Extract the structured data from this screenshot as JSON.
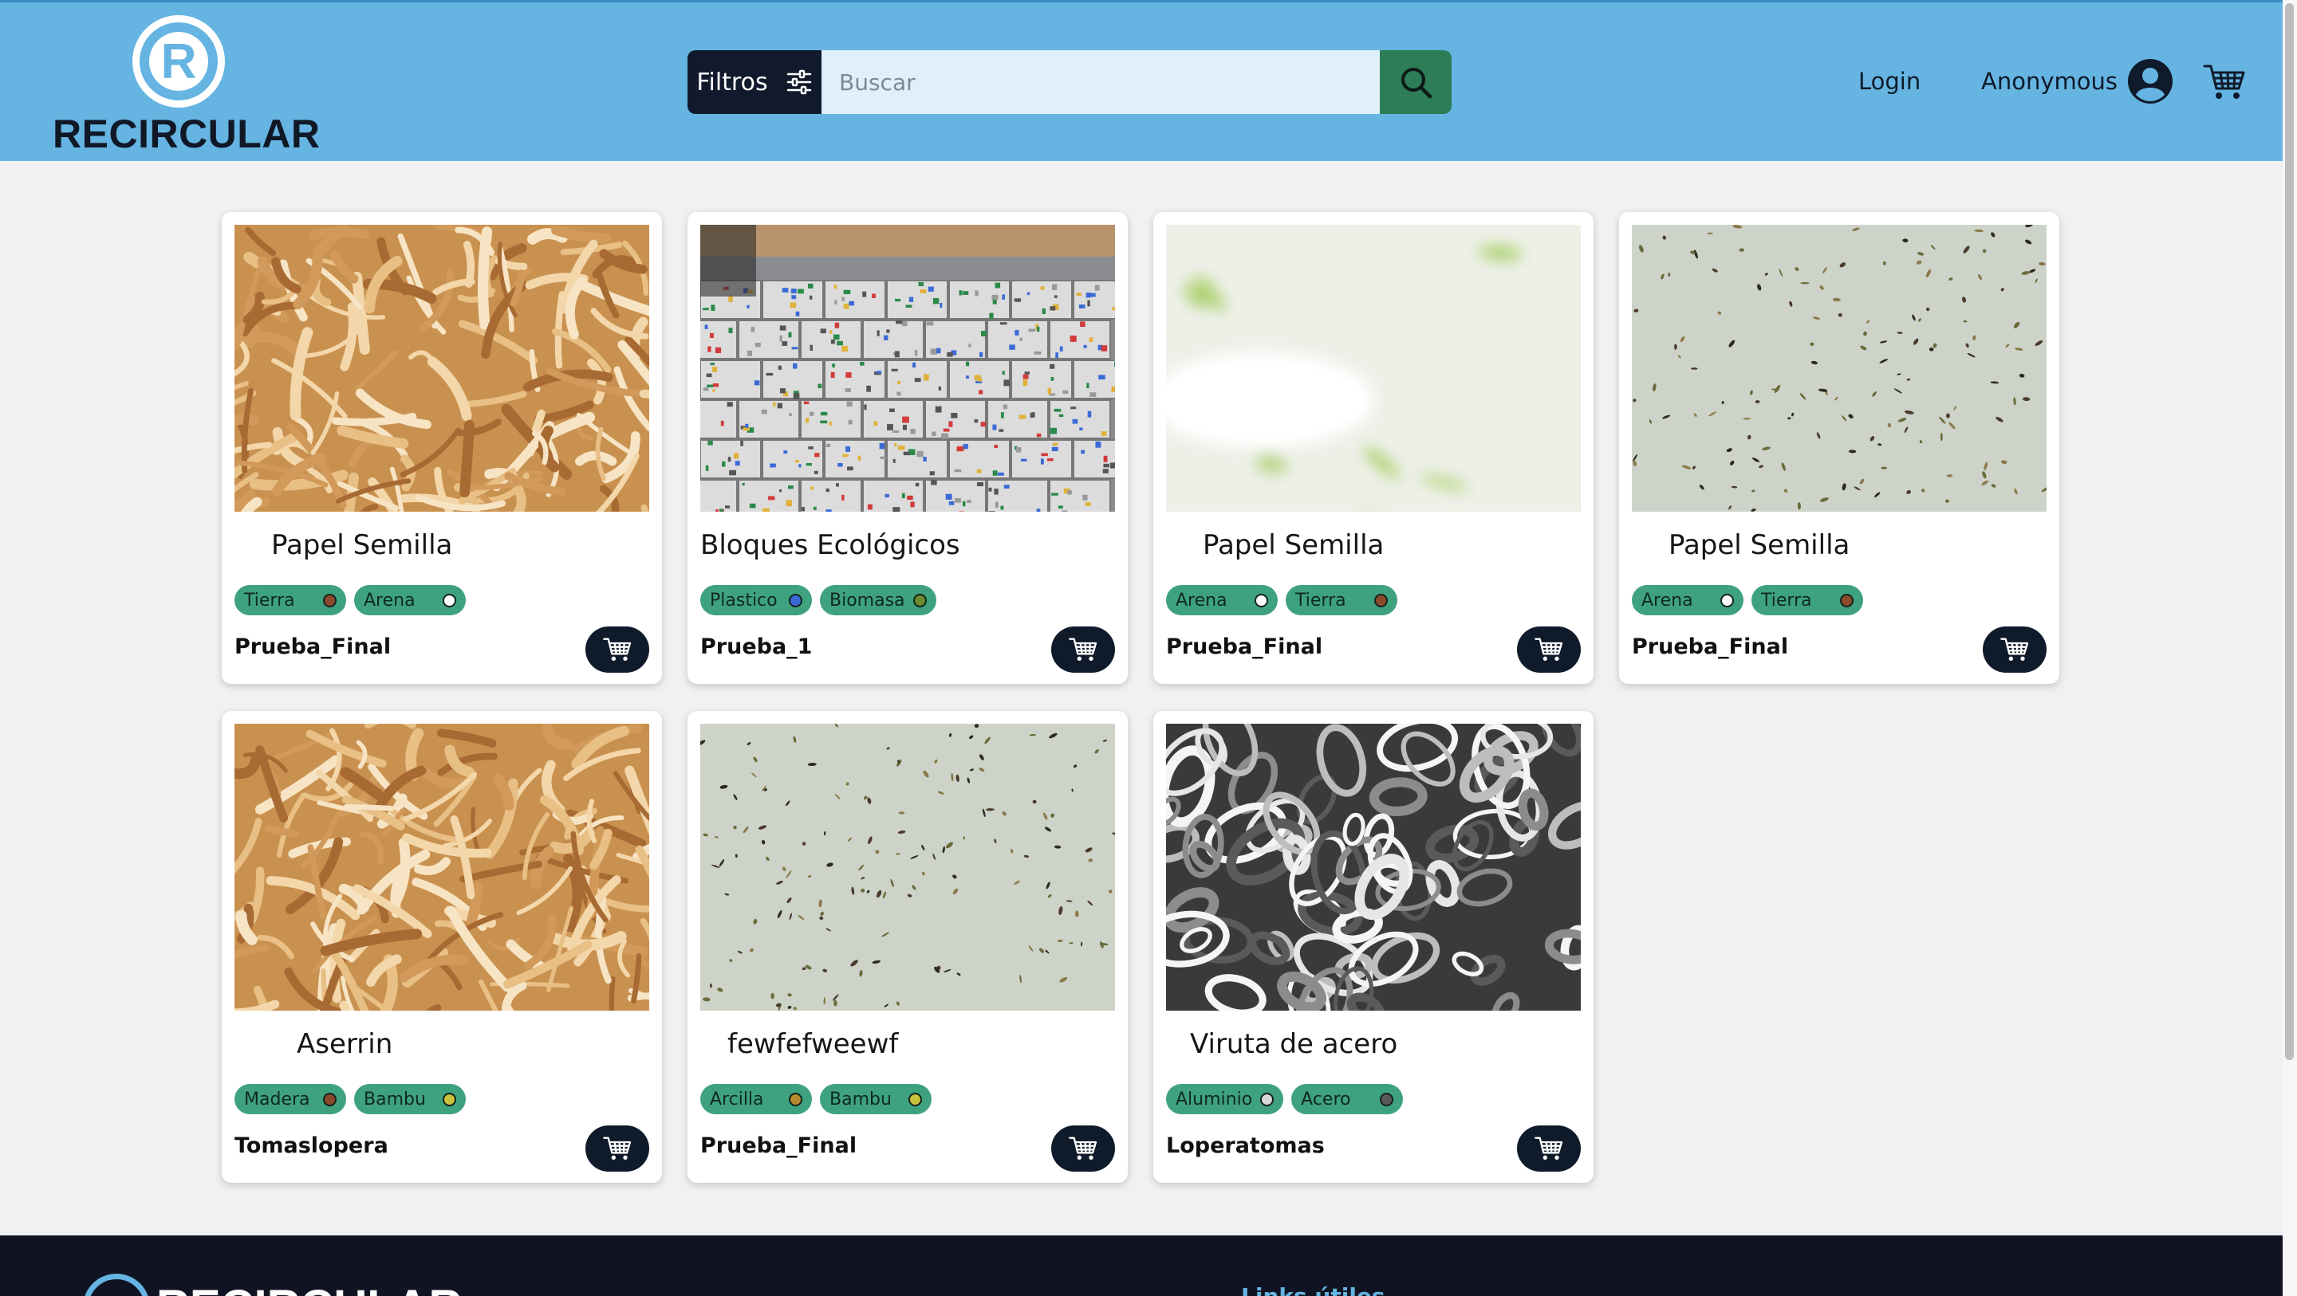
{
  "brand": {
    "name": "RECIRCULAR",
    "mark_letter": "R",
    "color": "#65b4e2"
  },
  "header": {
    "filters_label": "Filtros",
    "search_placeholder": "Buscar",
    "login_label": "Login",
    "user_label": "Anonymous",
    "filters_icon": "sliders-icon",
    "search_icon": "search-icon",
    "user_icon": "user-circle-icon",
    "cart_icon": "cart-icon"
  },
  "products": [
    {
      "title": "Papel Semilla",
      "image": "wood-shavings",
      "tags": [
        {
          "name": "Tierra",
          "dot": "#8b4a2b"
        },
        {
          "name": "Arena",
          "dot": "#ffffff"
        }
      ],
      "user": "Prueba_Final"
    },
    {
      "title": "Bloques Ecológicos",
      "image": "recycled-blocks",
      "tags": [
        {
          "name": "Plastico",
          "dot": "#3b6ad6"
        },
        {
          "name": "Biomasa",
          "dot": "#6b8a2b"
        }
      ],
      "user": "Prueba_1"
    },
    {
      "title": "Papel Semilla",
      "image": "seed-paper-blur",
      "tags": [
        {
          "name": "Arena",
          "dot": "#ffffff"
        },
        {
          "name": "Tierra",
          "dot": "#8b4a2b"
        }
      ],
      "user": "Prueba_Final"
    },
    {
      "title": "Papel Semilla",
      "image": "seed-paper",
      "tags": [
        {
          "name": "Arena",
          "dot": "#ffffff"
        },
        {
          "name": "Tierra",
          "dot": "#8b4a2b"
        }
      ],
      "user": "Prueba_Final"
    },
    {
      "title": "Aserrin",
      "image": "wood-shavings",
      "tags": [
        {
          "name": "Madera",
          "dot": "#8b4a2b"
        },
        {
          "name": "Bambu",
          "dot": "#c9c23a"
        }
      ],
      "user": "Tomaslopera"
    },
    {
      "title": "fewfefweewf",
      "image": "seed-paper",
      "tags": [
        {
          "name": "Arcilla",
          "dot": "#b8892b"
        },
        {
          "name": "Bambu",
          "dot": "#c9c23a"
        }
      ],
      "user": "Prueba_Final"
    },
    {
      "title": "Viruta de acero",
      "image": "steel-shavings",
      "tags": [
        {
          "name": "Aluminio",
          "dot": "#d8d8d8"
        },
        {
          "name": "Acero",
          "dot": "#5a5a5a"
        }
      ],
      "user": "Loperatomas"
    }
  ],
  "footer": {
    "brand": "RECIRCULAR",
    "link": "Links útiles"
  }
}
